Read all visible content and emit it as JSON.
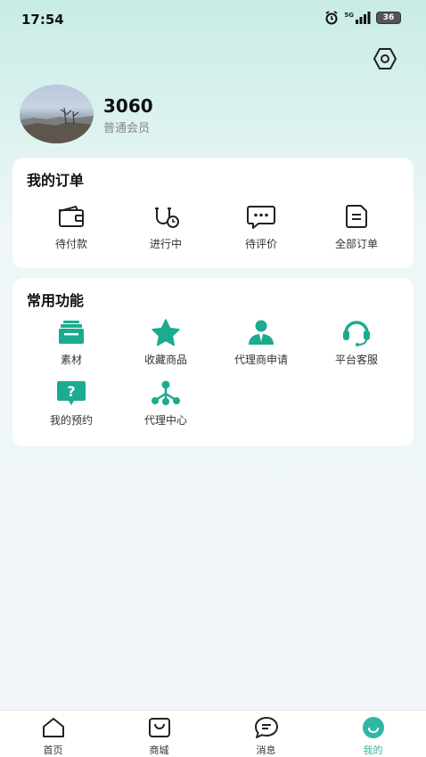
{
  "status_bar": {
    "time": "17:54",
    "network": "5G",
    "battery": "36",
    "icons": [
      "alarm-icon",
      "signal-icon",
      "battery-icon"
    ]
  },
  "profile": {
    "name": "3060",
    "level": "普通会员"
  },
  "orders": {
    "title": "我的订单",
    "items": [
      {
        "label": "待付款",
        "icon": "wallet-icon"
      },
      {
        "label": "进行中",
        "icon": "in-progress-icon"
      },
      {
        "label": "待评价",
        "icon": "comment-icon"
      },
      {
        "label": "全部订单",
        "icon": "all-orders-icon"
      }
    ]
  },
  "functions": {
    "title": "常用功能",
    "items": [
      {
        "label": "素材",
        "icon": "materials-icon"
      },
      {
        "label": "收藏商品",
        "icon": "star-icon"
      },
      {
        "label": "代理商申请",
        "icon": "agent-icon"
      },
      {
        "label": "平台客服",
        "icon": "headset-icon"
      },
      {
        "label": "我的预约",
        "icon": "question-icon"
      },
      {
        "label": "代理中心",
        "icon": "network-icon"
      }
    ]
  },
  "tabbar": {
    "items": [
      {
        "label": "首页",
        "icon": "home-icon"
      },
      {
        "label": "商城",
        "icon": "shop-bag-icon"
      },
      {
        "label": "消息",
        "icon": "message-icon"
      },
      {
        "label": "我的",
        "icon": "profile-smile-icon",
        "active": true
      }
    ]
  },
  "colors": {
    "accent": "#2fb7a4",
    "icon_green": "#1bab8f",
    "text_dark": "#111111",
    "text_muted": "#888888"
  }
}
